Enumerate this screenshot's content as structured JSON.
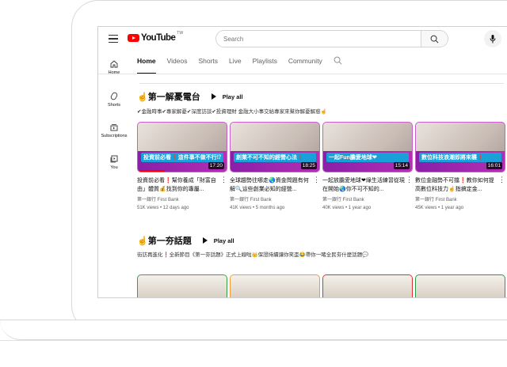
{
  "header": {
    "logo_text": "YouTube",
    "region": "TW",
    "search_placeholder": "Search"
  },
  "sidebar": {
    "items": [
      {
        "label": "Home",
        "icon": "home-icon"
      },
      {
        "label": "Shorts",
        "icon": "shorts-icon"
      },
      {
        "label": "Subscriptions",
        "icon": "subscriptions-icon"
      },
      {
        "label": "You",
        "icon": "you-icon"
      }
    ]
  },
  "tabs": [
    {
      "label": "Home",
      "active": true
    },
    {
      "label": "Videos"
    },
    {
      "label": "Shorts"
    },
    {
      "label": "Live"
    },
    {
      "label": "Playlists"
    },
    {
      "label": "Community"
    }
  ],
  "sections": [
    {
      "title": "☝第一解憂電台",
      "play_all": "Play all",
      "description": "✔金融時事✔專家解憂✔深度訪談✔投資理財 金融大小事交給專家來幫你解憂解惑☝",
      "videos": [
        {
          "thumb_caption": "投資前必看❗這件事不做不行⁉",
          "duration": "17:20",
          "title": "投資前必看❗幫你養成「財富自由」體質💰找到你的專屬...",
          "channel": "第一銀行 First Bank",
          "views": "51K views",
          "age": "12 days ago",
          "watched": 0.3
        },
        {
          "thumb_caption": "創業不可不知的經營心法❗",
          "duration": "18:25",
          "title": "全球趨勢往哪走🌏資金問題有何解🔍這些創業必知的經營...",
          "channel": "第一銀行 First Bank",
          "views": "41K views",
          "age": "5 months ago"
        },
        {
          "thumb_caption": "一起Fun膽愛地球❤",
          "duration": "15:14",
          "title": "一起放膽愛地球❤綠生活練習從現在開始🌏你不可不知的...",
          "channel": "第一銀行 First Bank",
          "views": "40K views",
          "age": "1 year ago"
        },
        {
          "thumb_caption": "數位科技浪潮即將來襲❗",
          "duration": "16:01",
          "title": "數位金融勢不可擋❗教你如何提高數位科技力☝指搞定金...",
          "channel": "第一銀行 First Bank",
          "views": "45K views",
          "age": "1 year ago"
        }
      ]
    },
    {
      "title": "☝第一夯話題",
      "play_all": "Play all",
      "description": "街訪再進化❗全新節目《第一夯話題》正式上線啦👑保證持續讓你笑歪😂帶你一睹全民夯什麼話題💬",
      "thumb_colors": [
        "#3aa04a",
        "#f39a3a",
        "#e0302e",
        "#2a9a4a"
      ]
    }
  ],
  "colors": {
    "brand": "#ff0000",
    "thumb_border": "#c85fc8"
  }
}
